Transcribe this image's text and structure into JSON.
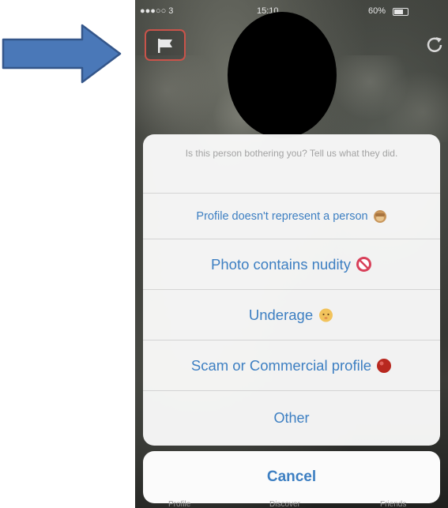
{
  "status_bar": {
    "carrier": "●●●○○ 3 ",
    "time": "15:10",
    "battery": "60%"
  },
  "report_sheet": {
    "prompt": "Is this person bothering you? Tell us what they did.",
    "options": [
      {
        "label": "Profile doesn't represent a person",
        "icon": "see-no-evil-emoji"
      },
      {
        "label": "Photo contains nudity",
        "icon": "no-under-18-emoji"
      },
      {
        "label": "Underage",
        "icon": "baby-face-emoji"
      },
      {
        "label": "Scam or Commercial profile",
        "icon": "red-circle-emoji"
      },
      {
        "label": "Other",
        "icon": ""
      }
    ],
    "cancel_label": "Cancel"
  },
  "tab_bar": [
    "Profile",
    "Discover",
    "Friends"
  ],
  "colors": {
    "accent_blue": "#3d7fc2",
    "arrow_fill": "#4a78b8",
    "flag_border": "#c9534a"
  },
  "icons": {
    "pointer": "arrow-right-icon",
    "flag": "flag-icon",
    "refresh": "refresh-icon"
  }
}
